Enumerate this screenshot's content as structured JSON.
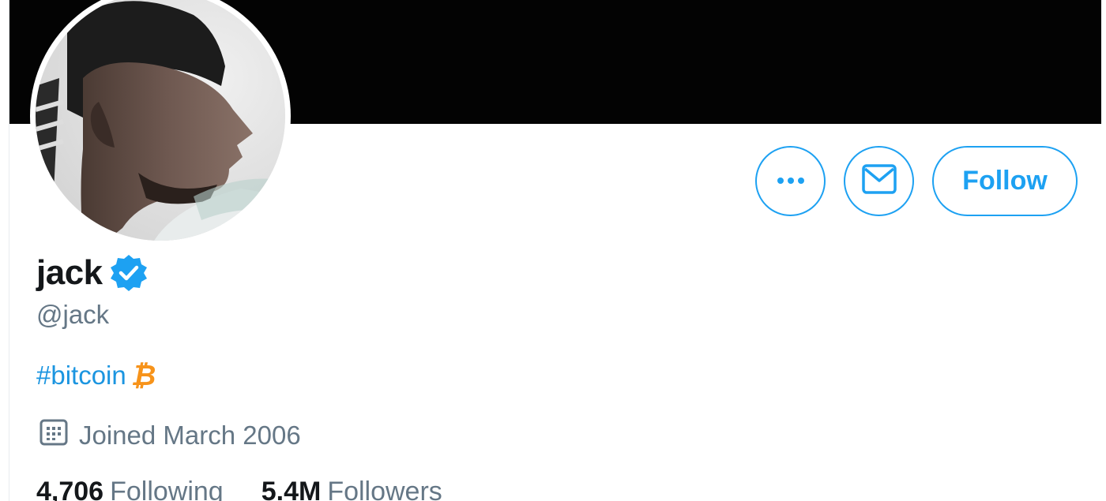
{
  "profile": {
    "display_name": "jack",
    "verified": true,
    "handle": "@jack",
    "bio_hashtag": "#bitcoin",
    "bio_emoji": "₿",
    "joined": "Joined March 2006"
  },
  "actions": {
    "more_icon": "more-horizontal-icon",
    "message_icon": "envelope-icon",
    "follow_label": "Follow"
  },
  "stats": {
    "following_count": "4,706",
    "following_label": "Following",
    "followers_count": "5.4M",
    "followers_label": "Followers"
  },
  "colors": {
    "accent": "#1da1f2",
    "banner": "#030303",
    "bitcoin": "#f7931a",
    "secondary_text": "#657786",
    "primary_text": "#14171a"
  }
}
